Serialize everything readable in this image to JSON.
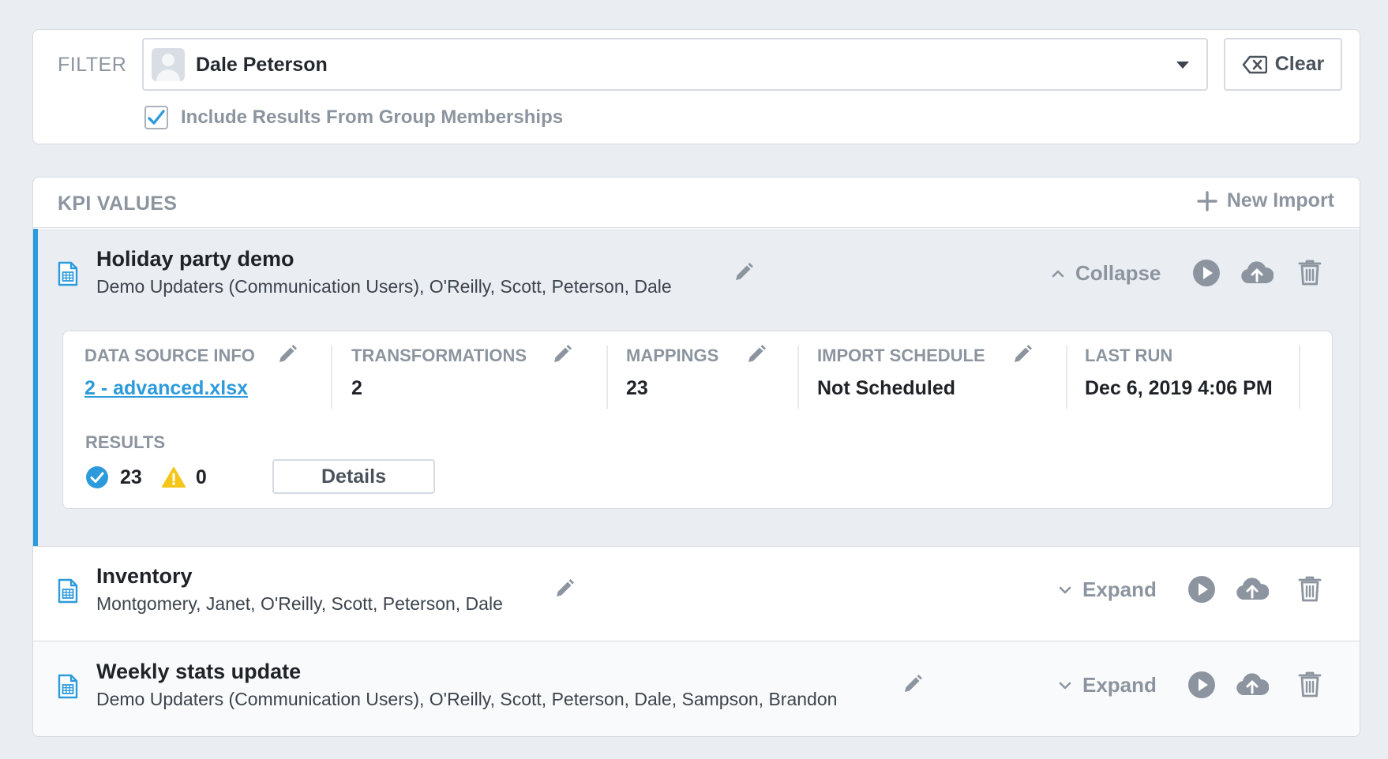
{
  "filter": {
    "label": "FILTER",
    "selected_user": "Dale Peterson",
    "clear_label": "Clear",
    "include_groups_label": "Include Results From Group Memberships",
    "include_groups_checked": true
  },
  "kpi": {
    "title": "KPI VALUES",
    "new_import_label": "New Import",
    "items": [
      {
        "title": "Holiday party demo",
        "subtitle": "Demo Updaters (Communication Users), O'Reilly, Scott, Peterson, Dale",
        "toggle_label": "Collapse",
        "expanded": true,
        "details": {
          "data_source_label": "DATA SOURCE INFO",
          "data_source_value": "2 - advanced.xlsx",
          "transformations_label": "TRANSFORMATIONS",
          "transformations_value": "2",
          "mappings_label": "MAPPINGS",
          "mappings_value": "23",
          "schedule_label": "IMPORT SCHEDULE",
          "schedule_value": "Not Scheduled",
          "last_run_label": "LAST RUN",
          "last_run_value": "Dec 6, 2019 4:06 PM",
          "results_label": "RESULTS",
          "success_count": "23",
          "warning_count": "0",
          "details_button": "Details"
        }
      },
      {
        "title": "Inventory",
        "subtitle": "Montgomery, Janet, O'Reilly, Scott, Peterson, Dale",
        "toggle_label": "Expand",
        "expanded": false
      },
      {
        "title": "Weekly stats update",
        "subtitle": "Demo Updaters (Communication Users), O'Reilly, Scott, Peterson, Dale, Sampson, Brandon",
        "toggle_label": "Expand",
        "expanded": false
      }
    ]
  },
  "colors": {
    "accent": "#2d9bdb",
    "warning": "#f5c518",
    "icon_gray": "#8c959f",
    "background": "#eaedf2"
  },
  "icons": [
    "user-avatar-icon",
    "dropdown-caret-icon",
    "backspace-icon",
    "checkmark-icon",
    "plus-icon",
    "spreadsheet-file-icon",
    "pencil-icon",
    "chevron-up-icon",
    "chevron-down-icon",
    "play-icon",
    "cloud-upload-icon",
    "trash-icon",
    "success-check-icon",
    "warning-icon"
  ]
}
